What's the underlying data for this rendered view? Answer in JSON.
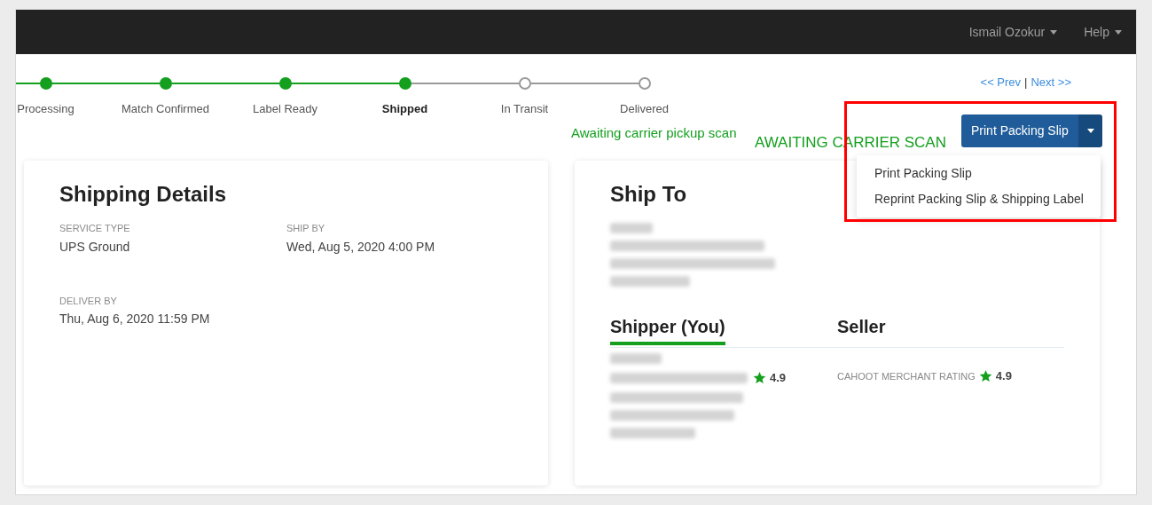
{
  "navbar": {
    "menus": [
      {
        "label": "Ismail Ozokur"
      },
      {
        "label": "Help"
      }
    ]
  },
  "progress": {
    "steps": [
      {
        "label": "Processing",
        "done": true,
        "selected": false
      },
      {
        "label": "Match Confirmed",
        "done": true,
        "selected": false
      },
      {
        "label": "Label Ready",
        "done": true,
        "selected": false
      },
      {
        "label": "Shipped",
        "done": true,
        "selected": true
      },
      {
        "label": "In Transit",
        "done": false,
        "selected": false
      },
      {
        "label": "Delivered",
        "done": false,
        "selected": false
      }
    ]
  },
  "pager": {
    "prev": "<< Prev",
    "separator": "|",
    "next": "Next >>"
  },
  "status": {
    "message": "Awaiting carrier pickup scan",
    "code": "AWAITING CARRIER SCAN"
  },
  "actions": {
    "button": "Print Packing Slip",
    "menu": {
      "expanded": true,
      "items": [
        "Print Packing Slip",
        "Reprint Packing Slip & Shipping Label"
      ]
    }
  },
  "shipping_details": {
    "title": "Shipping Details",
    "fields": [
      {
        "label": "SERVICE TYPE",
        "value": "UPS Ground"
      },
      {
        "label": "SHIP BY",
        "value": "Wed, Aug 5, 2020 4:00 PM"
      },
      {
        "label": "DELIVER BY",
        "value": "Thu, Aug 6, 2020 11:59 PM"
      }
    ]
  },
  "ship_to": {
    "title": "Ship To",
    "tabs": [
      {
        "label": "Shipper (You)",
        "selected": true
      },
      {
        "label": "Seller",
        "selected": false
      }
    ],
    "shipper": {
      "rating": "4.9"
    },
    "seller": {
      "rating_label": "CAHOOT MERCHANT RATING",
      "rating": "4.9"
    }
  }
}
